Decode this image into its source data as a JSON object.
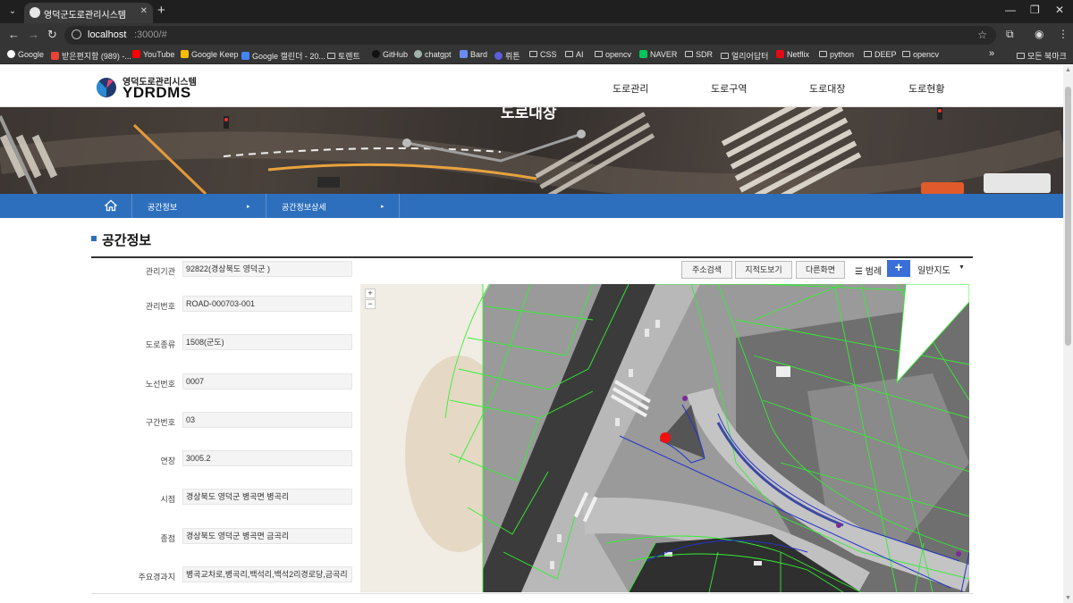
{
  "browser": {
    "tab_title": "영덕군도로관리시스템",
    "url_host": "localhost",
    "url_path": ":3000/#",
    "bookmarks": [
      "Google",
      "받은편지함 (989) -...",
      "YouTube",
      "Google Keep",
      "Google 캘린더 - 20...",
      "토렌트",
      "GitHub",
      "chatgpt",
      "Bard",
      "뤼튼",
      "CSS",
      "AI",
      "opencv",
      "NAVER",
      "SDR",
      "얼리어답터",
      "Netflix",
      "python",
      "DEEP",
      "opencv"
    ],
    "bookmarks_overflow": "»",
    "all_bookmarks": "모든 북마크"
  },
  "site": {
    "logo_kr": "영덕도로관리시스템",
    "logo_en": "YDRDMS",
    "nav": [
      "도로관리",
      "도로구역",
      "도로대장",
      "도로현황"
    ],
    "hero_title": "도로대장"
  },
  "breadcrumb": {
    "items": [
      "공간정보",
      "공간정보상세"
    ]
  },
  "section": {
    "title": "공간정보"
  },
  "info": {
    "rows": [
      {
        "label": "관리기관",
        "value": "92822(경상북도 영덕군 )"
      },
      {
        "label": "관리번호",
        "value": "ROAD-000703-001"
      },
      {
        "label": "도로종류",
        "value": "1508(군도)"
      },
      {
        "label": "노선번호",
        "value": "0007"
      },
      {
        "label": "구간번호",
        "value": "03"
      },
      {
        "label": "연장",
        "value": "3005.2"
      },
      {
        "label": "시점",
        "value": "경상북도 영덕군 병곡면 병곡리"
      },
      {
        "label": "종점",
        "value": "경상북도 영덕군 병곡면 금곡리"
      },
      {
        "label": "주요경과지",
        "value": "병곡교차로,병곡리,백석리,백석2리경로당,금곡리"
      }
    ]
  },
  "map_toolbar": {
    "address_search": "주소검색",
    "cadastral_view": "지적도보기",
    "other_screen": "다른화면",
    "legend": "범례",
    "plus": "+",
    "map_type": "일반지도"
  },
  "map": {
    "zoom_in": "+",
    "zoom_out": "−"
  }
}
